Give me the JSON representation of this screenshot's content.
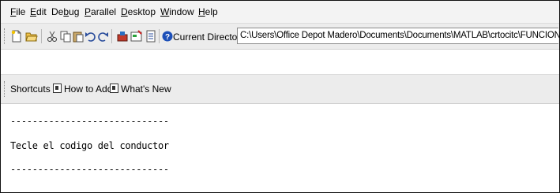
{
  "menu": [
    {
      "label": "File",
      "u": "F",
      "rest": "ile"
    },
    {
      "label": "Edit",
      "u": "E",
      "rest": "dit"
    },
    {
      "label": "Debug",
      "pre": "De",
      "u": "b",
      "rest": "ug"
    },
    {
      "label": "Parallel",
      "u": "P",
      "rest": "arallel"
    },
    {
      "label": "Desktop",
      "u": "D",
      "rest": "esktop"
    },
    {
      "label": "Window",
      "u": "W",
      "rest": "indow"
    },
    {
      "label": "Help",
      "u": "H",
      "rest": "elp"
    }
  ],
  "toolbar": {
    "icons": [
      "new-file-icon",
      "open-folder-icon",
      "cut-icon",
      "copy-icon",
      "paste-icon",
      "undo-icon",
      "redo-icon",
      "simulink-icon",
      "guide-icon",
      "profiler-icon",
      "help-icon"
    ],
    "current_directory_label": "Current Directory:",
    "current_directory_value": "C:\\Users\\Office Depot Madero\\Documents\\Documents\\MATLAB\\crtocitc\\FUNCIONES"
  },
  "shortcuts": {
    "label": "Shortcuts",
    "items": [
      "How to Add",
      "What's New"
    ]
  },
  "console": {
    "lines": [
      "-----------------------------",
      "Tecle el codigo del conductor",
      "-----------------------------"
    ]
  }
}
